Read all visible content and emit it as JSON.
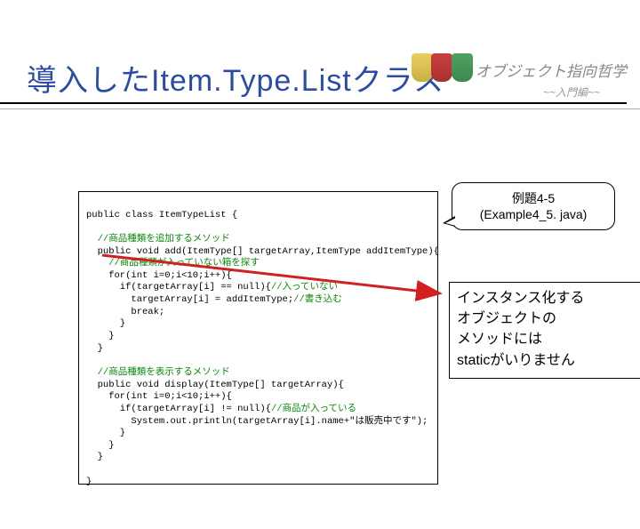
{
  "header": {
    "title": "オブジェクト指向哲学",
    "subtitle": "~~入門編~~"
  },
  "slide_title": "導入したItem.Type.Listクラス",
  "callout_top": {
    "line1": "例題4-5",
    "line2": "(Example4_5. java)"
  },
  "callout_box": {
    "line1": "インスタンス化する",
    "line2": "オブジェクトの",
    "line3": "メソッドには",
    "line4": "staticがいりません"
  },
  "code": {
    "l1": "public class ItemTypeList {",
    "l2_c": "  //商品種類を追加するメソッド",
    "l3": "  public void add(ItemType[] targetArray,ItemType addItemType){",
    "l4_c": "    //商品種類が入っていない箱を探す",
    "l5": "    for(int i=0;i<10;i++){",
    "l6a": "      if(targetArray[i] == null){",
    "l6b_c": "//入っていない",
    "l7a": "        targetArray[i] = addItemType;",
    "l7b_c": "//書き込む",
    "l8": "        break;",
    "l9": "      }",
    "l10": "    }",
    "l11": "  }",
    "l12_c": "  //商品種類を表示するメソッド",
    "l13": "  public void display(ItemType[] targetArray){",
    "l14": "    for(int i=0;i<10;i++){",
    "l15a": "      if(targetArray[i] != null){",
    "l15b_c": "//商品が入っている",
    "l16": "        System.out.println(targetArray[i].name+\"は販売中です\");",
    "l17": "      }",
    "l18": "    }",
    "l19": "  }",
    "l20": "}"
  }
}
